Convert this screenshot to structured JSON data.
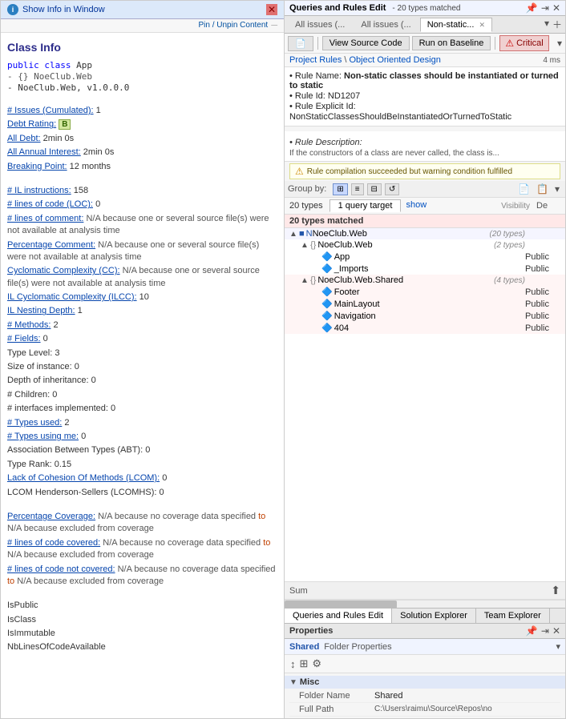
{
  "left": {
    "info_bar_title": "Show Info in Window",
    "pin_text": "Pin / Unpin Content",
    "class_info_title": "Class Info",
    "code_lines": [
      "public class App",
      "- {} NoeClub.Web",
      "- NoeClub.Web, v1.0.0.0"
    ],
    "props": [
      {
        "label": "# Issues (Cumulated):",
        "value": "1",
        "link": true
      },
      {
        "label": "Debt Rating:",
        "value": "B",
        "badge": true,
        "link": true
      },
      {
        "label": "All Debt:",
        "value": "2min  0s",
        "link": true
      },
      {
        "label": "All Annual Interest:",
        "value": "2min  0s",
        "link": true
      },
      {
        "label": "Breaking Point:",
        "value": "12 months",
        "link": true
      }
    ],
    "props2": [
      {
        "label": "# IL instructions:",
        "value": "158",
        "link": true
      },
      {
        "label": "# lines of code (LOC):",
        "value": "0",
        "link": true
      },
      {
        "label": "# lines of comment:",
        "value": "N/A because one or several source file(s) were not available at analysis time",
        "link": true,
        "na": true
      },
      {
        "label": "Percentage Comment:",
        "value": "N/A because one or several source file(s) were not available at analysis time",
        "link": true,
        "na": true
      },
      {
        "label": "Cyclomatic Complexity (CC):",
        "value": "N/A because one or several source file(s) were not available at analysis time",
        "link": true,
        "na": true
      },
      {
        "label": "IL Cyclomatic Complexity (ILCC):",
        "value": "10",
        "link": true
      },
      {
        "label": "IL Nesting Depth:",
        "value": "1",
        "link": true
      },
      {
        "label": "# Methods:",
        "value": "2",
        "link": true
      },
      {
        "label": "# Fields:",
        "value": "0",
        "link": true
      },
      {
        "label": "Type Level:",
        "value": "3"
      },
      {
        "label": "Size of instance:",
        "value": "0"
      },
      {
        "label": "Depth of inheritance:",
        "value": "0"
      },
      {
        "label": "# Children:",
        "value": "0"
      },
      {
        "label": "# interfaces implemented:",
        "value": "0"
      },
      {
        "label": "# Types used:",
        "value": "2",
        "link": true
      },
      {
        "label": "# Types using me:",
        "value": "0",
        "link": true
      },
      {
        "label": "Association Between Types (ABT):",
        "value": "0"
      },
      {
        "label": "Type Rank:",
        "value": "0.15"
      },
      {
        "label": "Lack of Cohesion Of Methods (LCOM):",
        "value": "0",
        "link": true
      },
      {
        "label": "LCOM Henderson-Sellers (LCOMHS):",
        "value": "0"
      }
    ],
    "props3": [
      {
        "label": "Percentage Coverage:",
        "value": "N/A because no coverage data specified  to  N/A because excluded from coverage",
        "link": true,
        "na": true
      },
      {
        "label": "# lines of code covered:",
        "value": "N/A because no coverage data specified  to  N/A because excluded from coverage",
        "link": true,
        "na": true
      },
      {
        "label": "# lines of code not covered:",
        "value": "N/A because no coverage data specified  to  N/A because excluded from coverage",
        "link": true,
        "na": true
      }
    ],
    "props4": [
      "IsPublic",
      "IsClass",
      "IsImmutable",
      "NbLinesOfCodeAvailable"
    ]
  },
  "right": {
    "header_title": "Queries and Rules Edit",
    "header_sub": "- 20 types matched",
    "tabs": [
      {
        "label": "All issues (...",
        "active": false
      },
      {
        "label": "All issues (...",
        "active": false
      },
      {
        "label": "Non-static...",
        "active": true
      }
    ],
    "toolbar": {
      "view_source": "View Source Code",
      "run_baseline": "Run on Baseline",
      "critical": "Critical"
    },
    "breadcrumb": {
      "items": [
        "Project Rules",
        "Object Oriented Design"
      ],
      "separator": "\\"
    },
    "time": "4 ms",
    "rule": {
      "name_label": "• Rule Name:",
      "name_value": "Non-static classes should be instantiated or turned to static",
      "id_label": "• Rule Id:",
      "id_value": "ND1207",
      "explicit_label": "• Rule Explicit Id:",
      "explicit_value": "NonStaticClassesShouldBeInstantiatedOrTurnedToStatic",
      "desc_label": "• Rule Description:",
      "desc_value": "If the constructors of a class are never called, the class is..."
    },
    "warn_text": "Rule compilation succeeded but warning condition fulfilled",
    "group_label": "Group by:",
    "group_btns": [
      "▦",
      "≡",
      "⊞",
      "↺",
      "📄",
      "📋"
    ],
    "count_label": "20 types",
    "query_tabs": [
      "1 query target",
      "show"
    ],
    "match_label": "20 types matched",
    "col_headers": [
      "",
      "Visibility",
      "De"
    ],
    "tree": [
      {
        "level": 1,
        "expand": "▲",
        "icon": "■N",
        "label": "NoeClub.Web",
        "meta": "(20 types)",
        "bg": "group2"
      },
      {
        "level": 2,
        "expand": "▲",
        "icon": "{}",
        "label": "NoeClub.Web",
        "meta": "(2 types)",
        "bg": ""
      },
      {
        "level": 3,
        "expand": "",
        "icon": "🔷",
        "label": "App",
        "vis": "Public",
        "bg": ""
      },
      {
        "level": 3,
        "expand": "",
        "icon": "🔷",
        "label": "_Imports",
        "vis": "Public",
        "bg": ""
      },
      {
        "level": 2,
        "expand": "▲",
        "icon": "{}",
        "label": "NoeClub.Web.Shared",
        "meta": "(4 types)",
        "bg": "group"
      },
      {
        "level": 3,
        "expand": "",
        "icon": "🔷",
        "label": "Footer",
        "vis": "Public",
        "bg": "group"
      },
      {
        "level": 3,
        "expand": "",
        "icon": "🔷",
        "label": "MainLayout",
        "vis": "Public",
        "bg": "group"
      },
      {
        "level": 3,
        "expand": "",
        "icon": "🔷",
        "label": "Navigation",
        "vis": "Public",
        "bg": "group"
      },
      {
        "level": 3,
        "expand": "",
        "icon": "🔷",
        "label": "404",
        "vis": "Public",
        "bg": "group"
      }
    ],
    "sum_label": "Sum",
    "bottom_tabs": [
      "Queries and Rules Edit",
      "Solution Explorer",
      "Team Explorer"
    ],
    "props": {
      "title": "Properties",
      "folder_label": "Shared",
      "folder_type": "Folder Properties",
      "section": "Misc",
      "rows": [
        {
          "key": "Folder Name",
          "val": "Shared",
          "blue": false
        },
        {
          "key": "Full Path",
          "val": "C:\\Users\\raimu\\Source\\Repos\\no",
          "long": true
        }
      ]
    }
  }
}
